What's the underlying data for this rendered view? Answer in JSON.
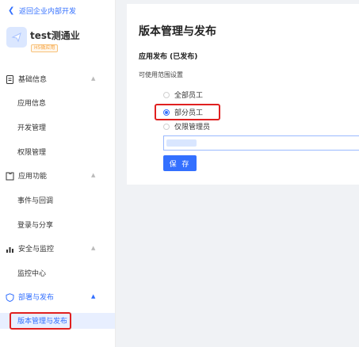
{
  "sidebar": {
    "back_label": "返回企业内部开发",
    "app": {
      "name": "test测通业",
      "badge": "H5微应用"
    },
    "groups": [
      {
        "icon": "document-icon",
        "label": "基础信息",
        "expanded": true,
        "items": [
          "应用信息",
          "开发管理",
          "权限管理"
        ]
      },
      {
        "icon": "puzzle-icon",
        "label": "应用功能",
        "expanded": true,
        "items": [
          "事件与回调",
          "登录与分享"
        ]
      },
      {
        "icon": "chart-icon",
        "label": "安全与监控",
        "expanded": true,
        "items": [
          "监控中心"
        ]
      },
      {
        "icon": "shield-icon",
        "label": "部署与发布",
        "expanded": true,
        "active": true,
        "items": [
          "版本管理与发布"
        ]
      }
    ]
  },
  "main": {
    "title": "版本管理与发布",
    "section_title": "应用发布 (已发布)",
    "scope_label": "可使用范围设置",
    "options": [
      {
        "label": "全部员工",
        "checked": false
      },
      {
        "label": "部分员工",
        "checked": true
      },
      {
        "label": "仅限管理员",
        "checked": false
      }
    ],
    "save_label": "保 存"
  },
  "colors": {
    "accent": "#3370ff",
    "highlight": "#e02020",
    "badge": "#f7a13b"
  }
}
